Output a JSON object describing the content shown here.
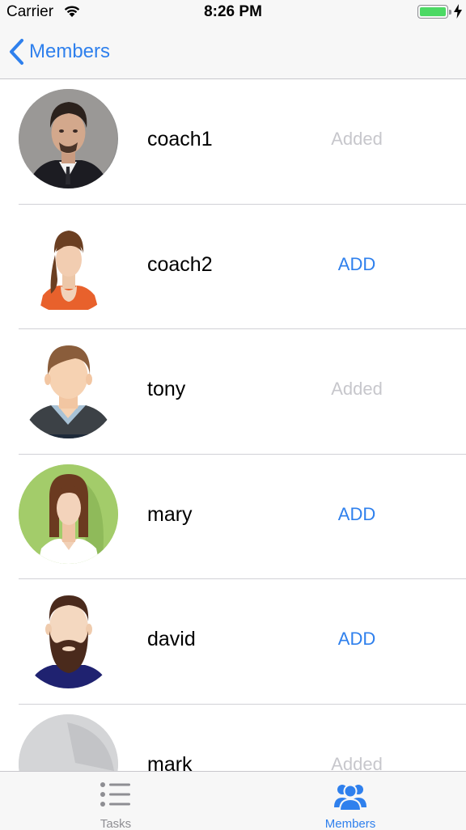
{
  "status_bar": {
    "carrier": "Carrier",
    "time": "8:26 PM",
    "wifi_icon": "wifi-icon",
    "battery_icon": "battery-icon",
    "charging_icon": "charging-bolt-icon",
    "battery_level": 1.0
  },
  "nav": {
    "back_label": "Members",
    "back_icon": "chevron-left-icon"
  },
  "members": [
    {
      "name": "coach1",
      "action": "Added",
      "avatar": "photo-avatar-man-suit"
    },
    {
      "name": "coach2",
      "action": "ADD",
      "avatar": "avatar-woman-ponytail"
    },
    {
      "name": "tony",
      "action": "Added",
      "avatar": "avatar-man-sweater"
    },
    {
      "name": "mary",
      "action": "ADD",
      "avatar": "avatar-woman-green"
    },
    {
      "name": "david",
      "action": "ADD",
      "avatar": "avatar-man-beard"
    },
    {
      "name": "mark",
      "action": "Added",
      "avatar": "avatar-grey-photo"
    }
  ],
  "tabs": [
    {
      "label": "Tasks",
      "icon": "list-icon",
      "active": false
    },
    {
      "label": "Members",
      "icon": "people-icon",
      "active": true
    }
  ],
  "colors": {
    "accent": "#2f80ed",
    "added_text": "#c7c7cc",
    "bar_background": "#f7f7f7",
    "battery_green": "#4cd964"
  }
}
